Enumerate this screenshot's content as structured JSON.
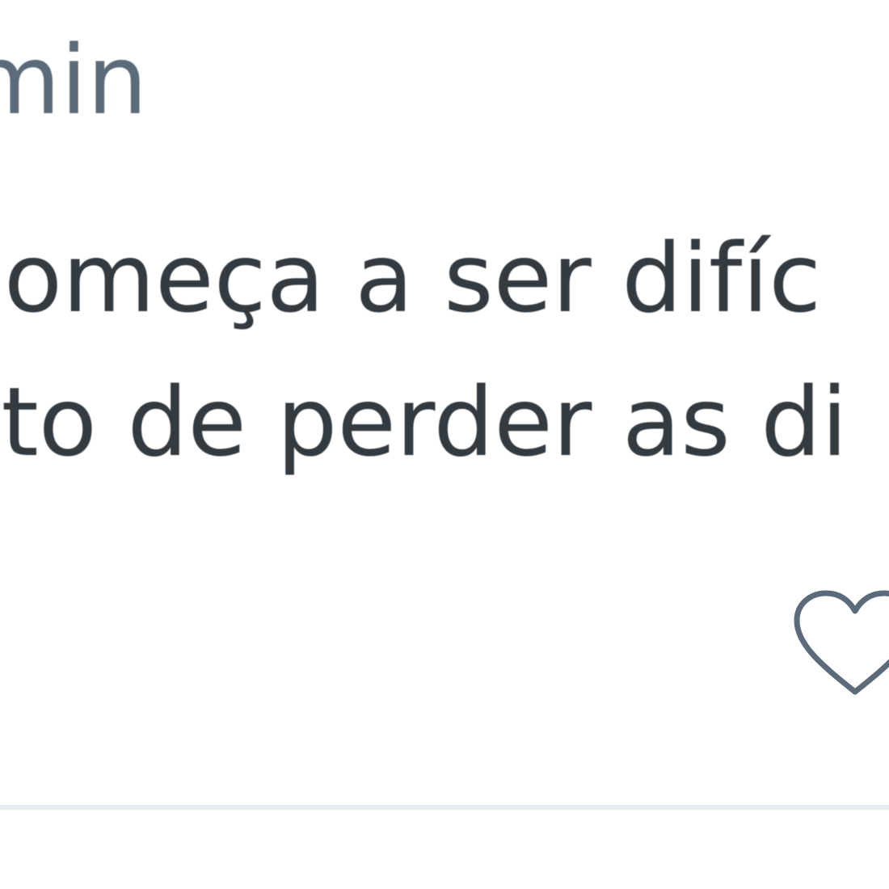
{
  "post": {
    "timestamp": "min",
    "body_lines": [
      " começa a ser difíc",
      "sto de perder as di"
    ]
  },
  "actions": {
    "like_icon": "heart-outline-icon"
  },
  "colors": {
    "timestamp": "#5b6b7a",
    "text": "#333a40",
    "icon": "#5b6b7a",
    "divider": "#e6ecf0",
    "background": "#ffffff"
  }
}
